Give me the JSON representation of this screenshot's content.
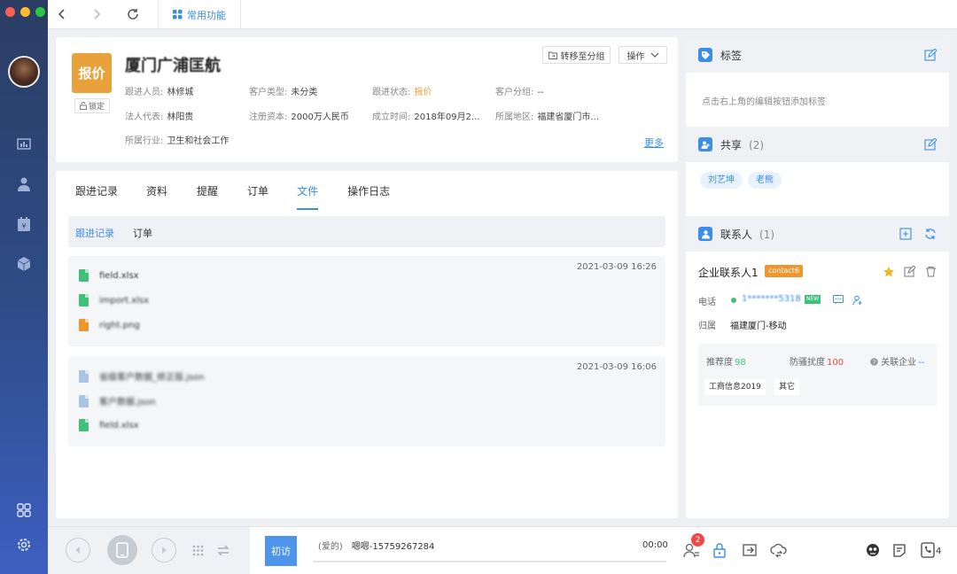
{
  "topbar": {
    "common_tab_label": "常用功能"
  },
  "customer": {
    "status_badge": "报价",
    "lock_label": "锁定",
    "name": "厦门广浦匡航",
    "fields": {
      "follower_label": "跟进人员:",
      "follower_value": "林修城",
      "type_label": "客户类型:",
      "type_value": "未分类",
      "follow_status_label": "跟进状态:",
      "follow_status_value": "报价",
      "group_label": "客户分组:",
      "group_value": "--",
      "legal_rep_label": "法人代表:",
      "legal_rep_value": "林阳贵",
      "capital_label": "注册资本:",
      "capital_value": "2000万人民币",
      "established_label": "成立时间:",
      "established_value": "2018年09月2...",
      "region_label": "所属地区:",
      "region_value": "福建省厦门市...",
      "industry_label": "所属行业:",
      "industry_value": "卫生和社会工作"
    },
    "move_group_label": "转移至分组",
    "operate_label": "操作",
    "more_label": "更多"
  },
  "tabs": [
    "跟进记录",
    "资料",
    "提醒",
    "订单",
    "文件",
    "操作日志"
  ],
  "active_tab": "文件",
  "subtabs": [
    "跟进记录",
    "订单"
  ],
  "file_groups": [
    {
      "time": "2021-03-09 16:26",
      "files": [
        {
          "name": "field.xlsx",
          "color": "green"
        },
        {
          "name": "import.xlsx",
          "color": "green"
        },
        {
          "name": "right.png",
          "color": "orange"
        }
      ]
    },
    {
      "time": "2021-03-09 16:06",
      "files": [
        {
          "name": "省级客户数据_修正版.json",
          "color": "blue"
        },
        {
          "name": "客户数据.json",
          "color": "blue"
        },
        {
          "name": "field.xlsx",
          "color": "green"
        }
      ]
    }
  ],
  "right": {
    "tags_title": "标签",
    "tags_hint": "点击右上角的编辑按钮添加标签",
    "share_title": "共享",
    "share_count": "(2)",
    "share_people": [
      "刘艺坤",
      "老熊"
    ],
    "contacts_title": "联系人",
    "contacts_count": "(1)",
    "contact": {
      "name": "企业联系人1",
      "tag": "contact6",
      "phone_label": "电话",
      "phone_value": "1*******5318",
      "new_tag": "NEW",
      "belong_label": "归属",
      "belong_value": "福建厦门-移动",
      "recommend_label": "推荐度",
      "recommend_value": "98",
      "harass_label": "防骚扰度",
      "harass_value": "100",
      "related_label": "关联企业",
      "related_value": "--",
      "tags": [
        "工商信息2019",
        "其它"
      ]
    }
  },
  "bottom": {
    "first_visit_label": "初访",
    "caller_note": "(爱的)",
    "caller": "嗯嗯-15759267284",
    "duration": "00:00",
    "notification_count": "2",
    "phone_count": "4"
  }
}
